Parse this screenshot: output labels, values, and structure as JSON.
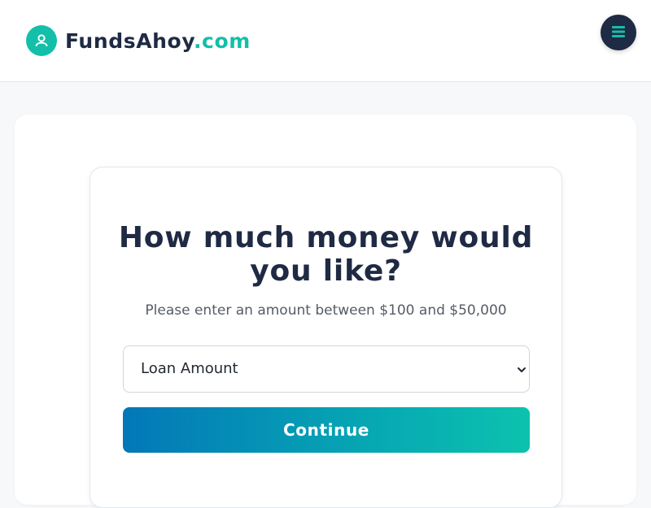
{
  "header": {
    "brand_name": "FundsAhoy",
    "brand_tld": ".com",
    "logo_icon": "user-circle-icon",
    "menu_icon": "hamburger-menu-icon"
  },
  "form": {
    "heading": "How much money would you like?",
    "subtext": "Please enter an amount between $100 and $50,000",
    "amount_select": {
      "selected": "Loan Amount",
      "icon": "chevron-down-icon"
    },
    "continue_label": "Continue"
  },
  "colors": {
    "brand_teal": "#13bfa8",
    "navy": "#1f2a44",
    "button_gradient_start": "#0377b8",
    "button_gradient_end": "#0cc2ae",
    "page_background": "#f7f8fa"
  }
}
